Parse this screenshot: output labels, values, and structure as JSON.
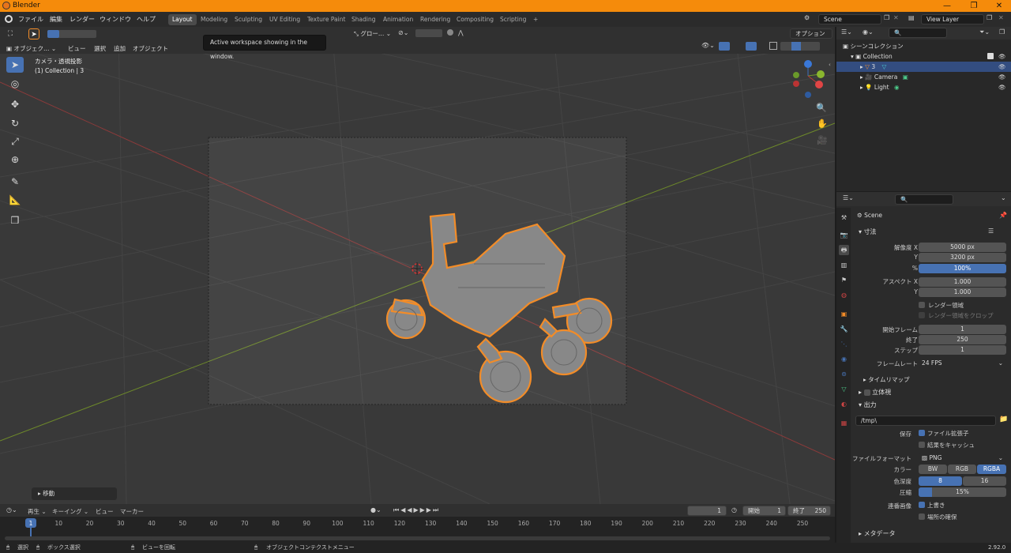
{
  "window": {
    "title": "Blender",
    "minimize": "—",
    "maximize": "❐",
    "close": "✕"
  },
  "menu": [
    "ファイル",
    "編集",
    "レンダー",
    "ウィンドウ",
    "ヘルプ"
  ],
  "workspaces": [
    "Layout",
    "Modeling",
    "Sculpting",
    "UV Editing",
    "Texture Paint",
    "Shading",
    "Animation",
    "Rendering",
    "Compositing",
    "Scripting"
  ],
  "active_workspace": "Layout",
  "add_workspace": "+",
  "scene": {
    "name": "Scene",
    "view_layer": "View Layer"
  },
  "tooltip": "Active workspace showing in the window.",
  "viewport": {
    "mode": "オブジェク…",
    "menus": [
      "ビュー",
      "選択",
      "追加",
      "オブジェクト"
    ],
    "transform_orientation": "グロー…",
    "options": "オプション",
    "view_name": "カメラ・透視投影",
    "collection_info": "(1) Collection | 3",
    "last_op": "移動",
    "gizmo": {
      "x": "X",
      "y": "Y",
      "z": "Z"
    }
  },
  "outliner": {
    "search_placeholder": "",
    "root": "シーンコレクション",
    "collection": "Collection",
    "items": [
      "3",
      "Camera",
      "Light"
    ]
  },
  "properties": {
    "scene": "Scene",
    "dimensions": "寸法",
    "res_x_label": "解像度 X",
    "res_x": "5000 px",
    "res_y_label": "Y",
    "res_y": "3200 px",
    "pct_label": "%",
    "pct": "100%",
    "aspect_x_label": "アスペクト X",
    "aspect_x": "1.000",
    "aspect_y_label": "Y",
    "aspect_y": "1.000",
    "render_region": "レンダー領域",
    "crop_region": "レンダー領域をクロップ",
    "frame_start_label": "開始フレーム",
    "frame_start": "1",
    "frame_end_label": "終了",
    "frame_end": "250",
    "frame_step_label": "ステップ",
    "frame_step": "1",
    "fps_label": "フレームレート",
    "fps": "24 FPS",
    "time_remap": "タイムリマップ",
    "stereo": "立体視",
    "output": "出力",
    "path": "/tmp\\",
    "save_label": "保存",
    "file_ext": "ファイル拡張子",
    "cache": "結果をキャッシュ",
    "format_label": "ファイルフォーマット",
    "format": "PNG",
    "color_label": "カラー",
    "color_opts": [
      "BW",
      "RGB",
      "RGBA"
    ],
    "color_selected": "RGBA",
    "depth_label": "色深度",
    "depth_opts": [
      "8",
      "16"
    ],
    "depth_selected": "8",
    "compression_label": "圧縮",
    "compression": "15%",
    "compression_frac": 0.15,
    "seq_label": "連番画像",
    "overwrite": "上書き",
    "placeholders": "場所の確保",
    "metadata": "メタデータ"
  },
  "timeline": {
    "menus": [
      "再生",
      "キーイング",
      "ビュー",
      "マーカー"
    ],
    "current_frame": "1",
    "start_label": "開始",
    "start": "1",
    "end_label": "終了",
    "end": "250",
    "ticks": [
      "1",
      "10",
      "20",
      "30",
      "40",
      "50",
      "60",
      "70",
      "80",
      "90",
      "100",
      "110",
      "120",
      "130",
      "140",
      "150",
      "160",
      "170",
      "180",
      "190",
      "200",
      "210",
      "220",
      "230",
      "240",
      "250"
    ]
  },
  "status": {
    "select": "選択",
    "box_select": "ボックス選択",
    "rotate_view": "ビューを回転",
    "context_menu": "オブジェクトコンテクストメニュー",
    "version": "2.92.0"
  },
  "colors": {
    "accent": "#4772b3",
    "title_bar": "#f58b0b",
    "selection_outline": "#f28c28"
  },
  "icons": [
    "blender-logo-icon",
    "cursor-icon",
    "move-icon",
    "rotate-icon",
    "scale-icon",
    "transform-icon",
    "annotate-icon",
    "measure-icon",
    "add-cube-icon",
    "zoom-icon",
    "hand-icon",
    "camera-icon"
  ]
}
